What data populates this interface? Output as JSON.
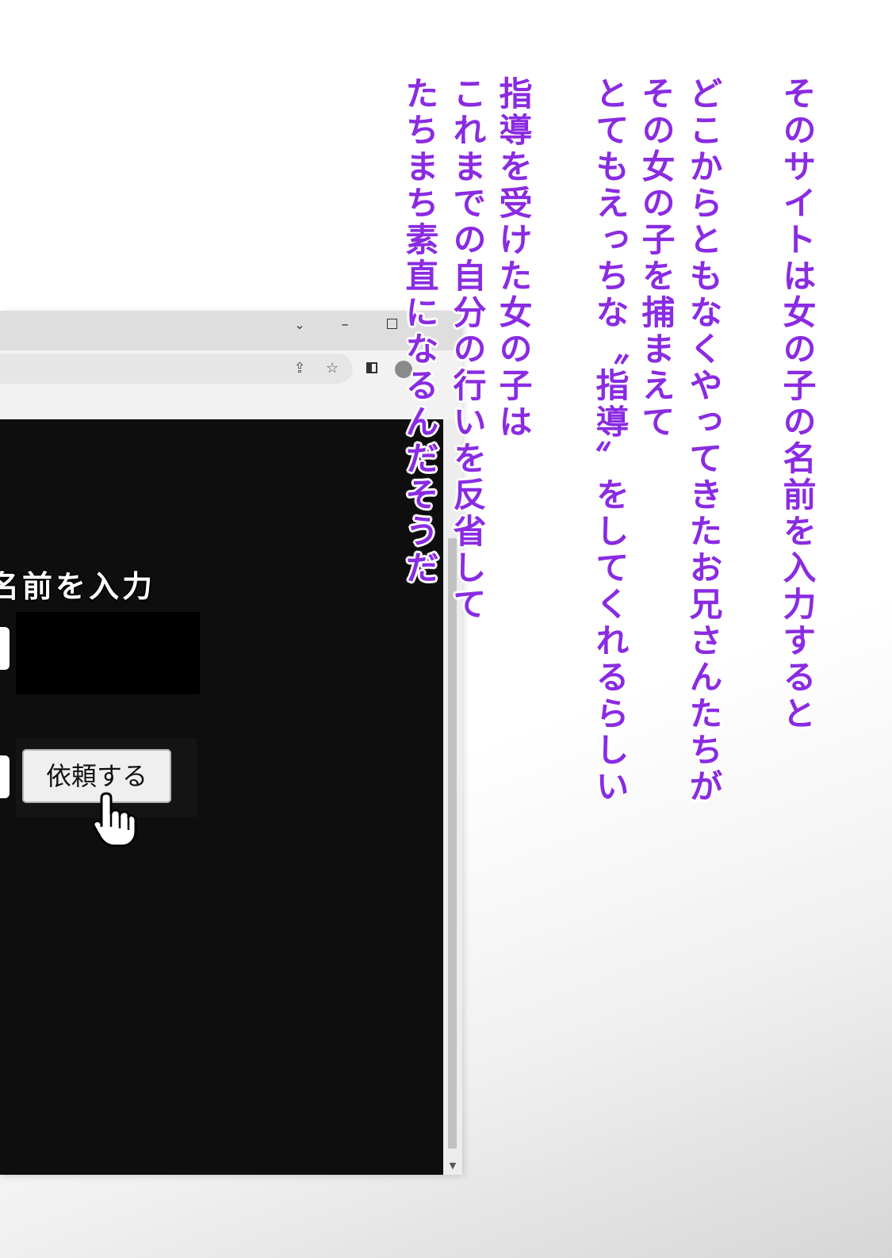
{
  "browser": {
    "window_controls": {
      "chevron": "⌄",
      "minimize": "–"
    },
    "toolbar": {
      "share_icon": "⇪",
      "star_icon": "☆"
    },
    "page": {
      "heading": "名前を入力",
      "request_button_label": "依頼する"
    },
    "scrollbar": {
      "down_arrow": "▼"
    }
  },
  "narration": {
    "lines": [
      "そのサイトは女の子の名前を入力すると",
      "どこからともなくやってきたお兄さんたちが",
      "その女の子を捕まえて",
      "とてもえっちな〝指導〟をしてくれるらしい",
      "指導を受けた女の子は",
      "これまでの自分の行いを反省して",
      "たちまち素直になるんだそうだ"
    ]
  },
  "colors": {
    "narration_text": "#8a2be2",
    "page_background": "#0e0e0e",
    "titlebar": "#dedede"
  }
}
